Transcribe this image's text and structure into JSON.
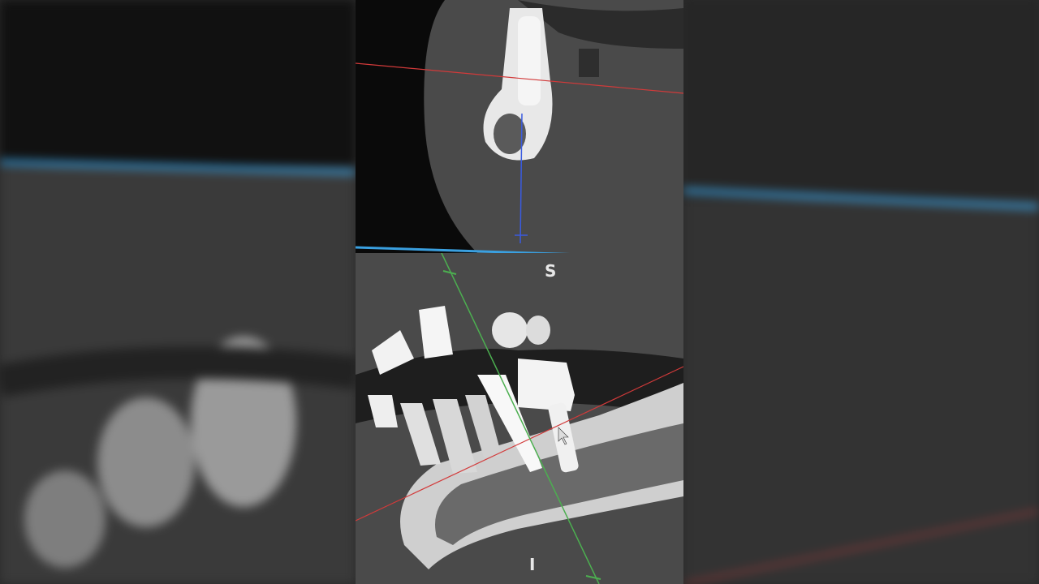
{
  "viewer": {
    "orientation_superior": "S",
    "orientation_inferior": "I"
  },
  "colors": {
    "axial_line": "#3aa0e0",
    "sagittal_line": "#4caf50",
    "coronal_line": "#d23a3a",
    "measure_line": "#3a5be0",
    "bone": "#d8d8d8",
    "soft_tissue": "#4a4a4a"
  },
  "icons": {
    "cursor": "mouse-pointer-icon"
  }
}
